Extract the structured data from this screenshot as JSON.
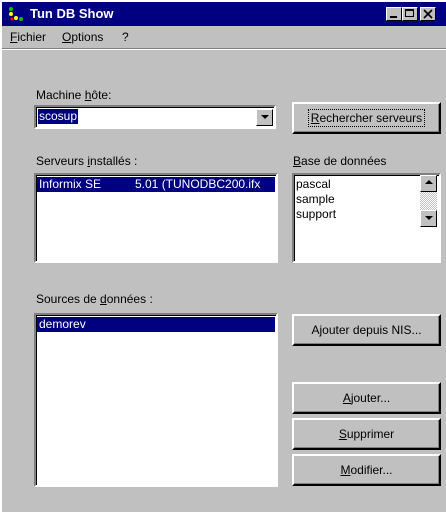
{
  "window": {
    "title": "Tun DB Show"
  },
  "menu": {
    "items": [
      "Fichier",
      "Options",
      "?"
    ]
  },
  "host": {
    "label_pre": "Machine ",
    "label_ul": "h",
    "label_post": "ôte:",
    "value": "scosup"
  },
  "search_button": {
    "label_ul": "R",
    "label_post": "echercher serveurs"
  },
  "servers": {
    "label_pre": "Serveurs ",
    "label_ul": "i",
    "label_post": "nstallés :",
    "rows": [
      {
        "name": "Informix SE",
        "version": "5.01 (TUNODBC200.ifx"
      }
    ]
  },
  "databases": {
    "label_ul": "B",
    "label_post": "ase de données",
    "items": [
      "pascal",
      "sample",
      "support"
    ]
  },
  "sources": {
    "label_pre": "Sources de ",
    "label_ul": "d",
    "label_post": "onnées :",
    "items": [
      "demorev"
    ]
  },
  "buttons": {
    "add_nis": "Ajouter depuis NIS...",
    "add_ul": "A",
    "add_post": "jouter...",
    "delete_ul": "S",
    "delete_post": "upprimer",
    "modify_ul": "M",
    "modify_post": "odifier..."
  },
  "colors": {
    "titlebar": "#000080",
    "face": "#c0c0c0",
    "selection": "#000080"
  }
}
